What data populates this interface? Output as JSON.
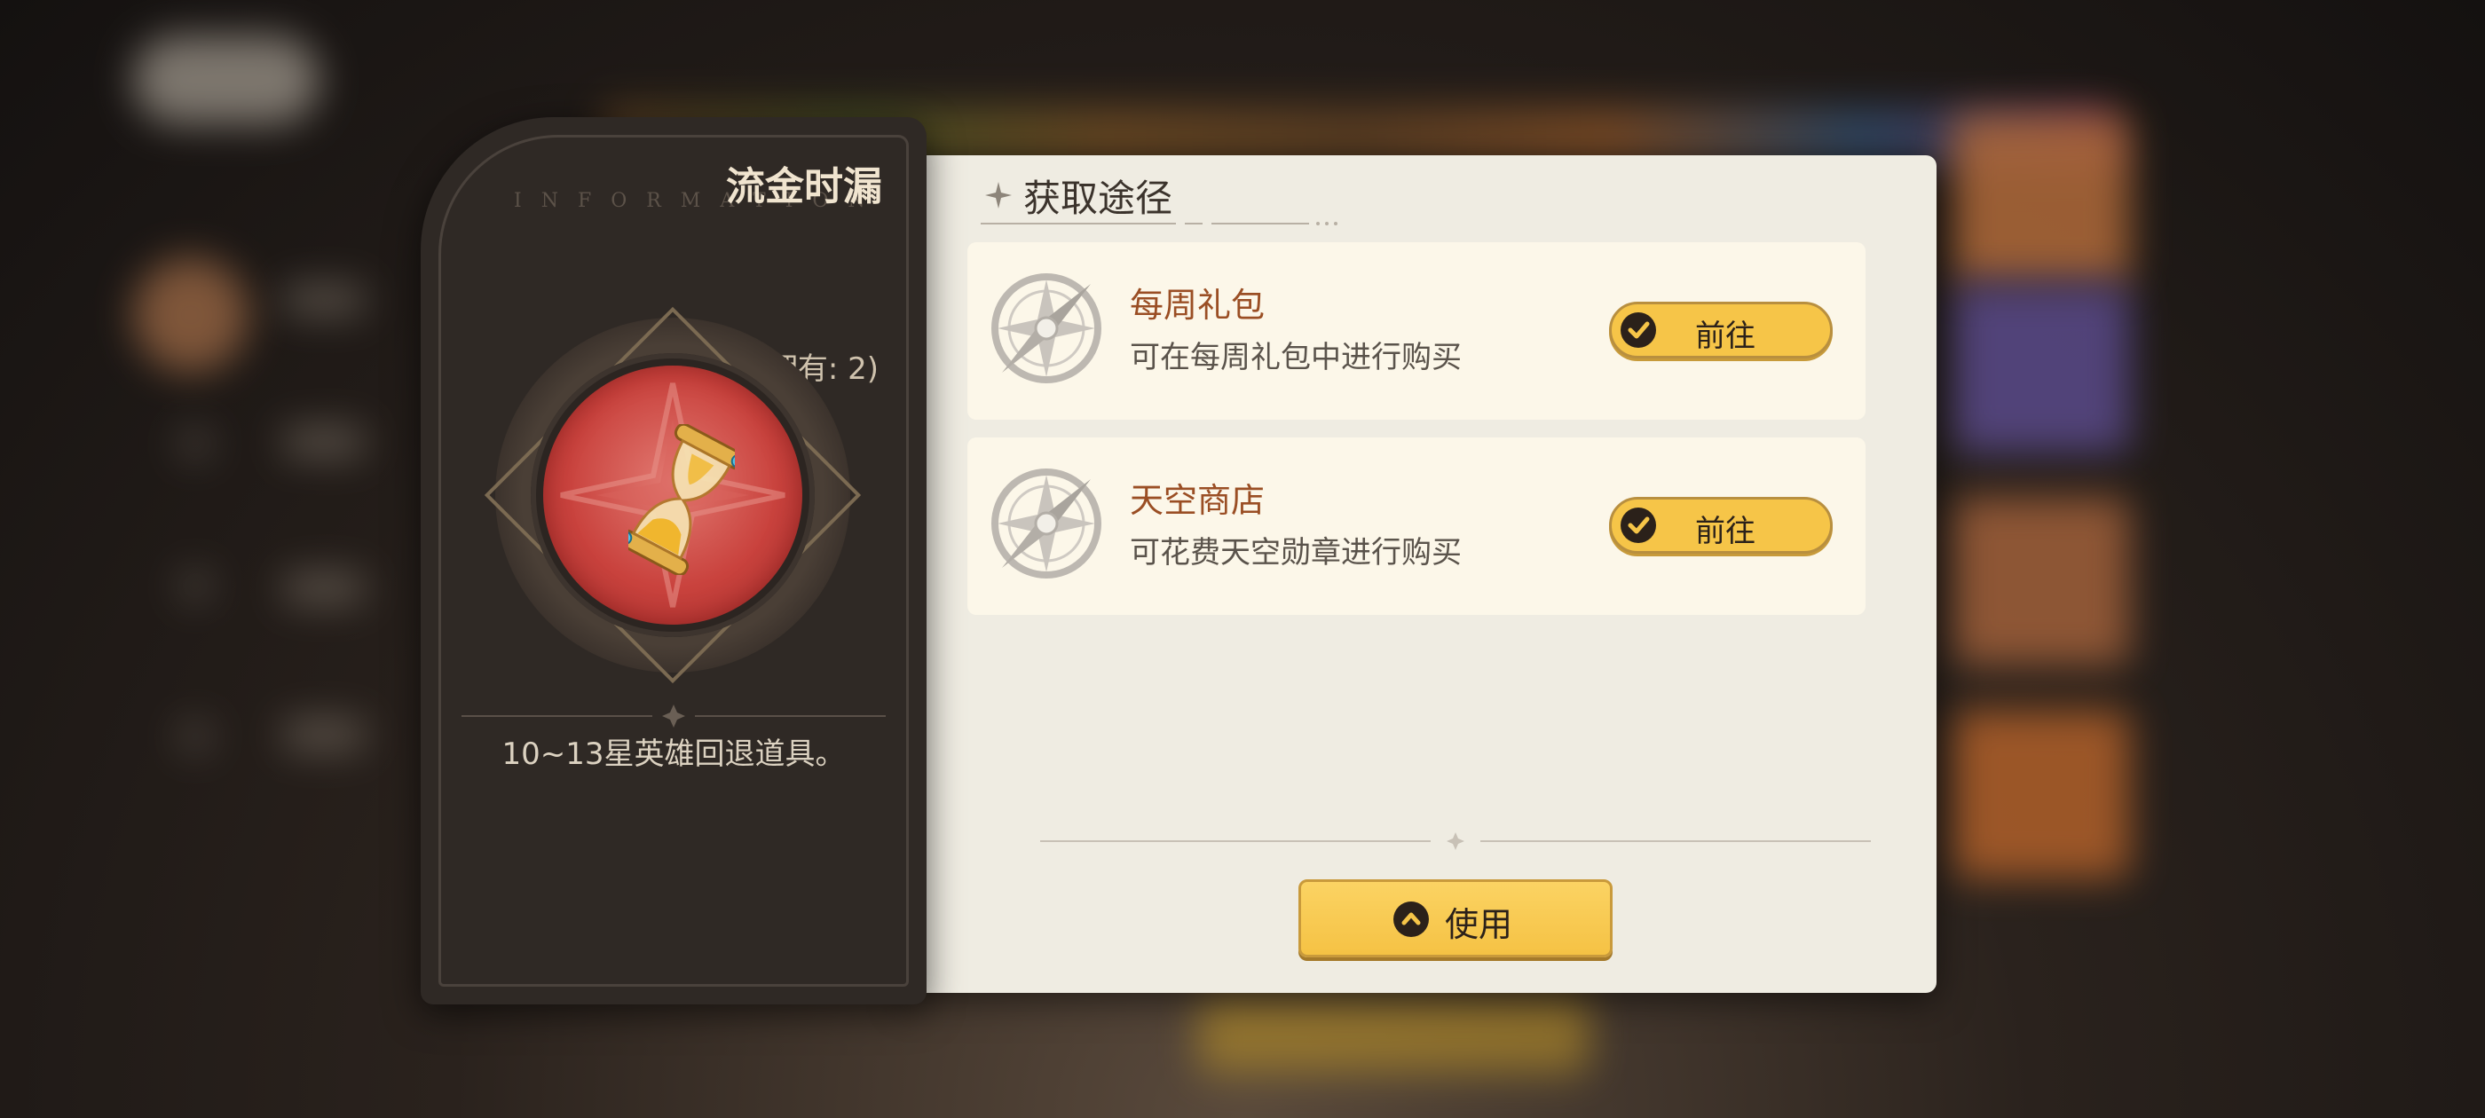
{
  "item": {
    "name": "流金时漏",
    "watermark": "INFORMATION",
    "owned_text": "(拥有: 2)",
    "description": "10~13星英雄回退道具。",
    "icon": "hourglass-icon"
  },
  "sources": {
    "title": "获取途径",
    "items": [
      {
        "name": "每周礼包",
        "description": "可在每周礼包中进行购买",
        "button_label": "前往",
        "icon": "compass-icon"
      },
      {
        "name": "天空商店",
        "description": "可花费天空勋章进行购买",
        "button_label": "前往",
        "icon": "compass-icon"
      }
    ]
  },
  "use_button": {
    "label": "使用"
  },
  "colors": {
    "panel_dark": "#2f2925",
    "panel_light": "#efece2",
    "card": "#fcf7e9",
    "accent_gold": "#f6c548",
    "source_name": "#9a4e24",
    "orb_red": "#c9423d"
  }
}
